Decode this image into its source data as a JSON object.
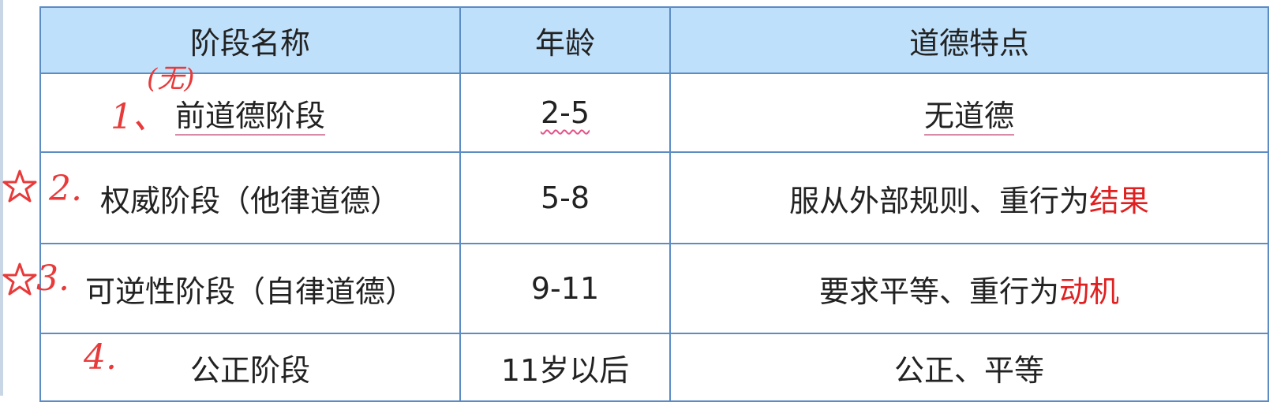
{
  "table": {
    "headers": [
      "阶段名称",
      "年龄",
      "道德特点"
    ],
    "rows": [
      {
        "stage_num": "1、",
        "stage": "前道德阶段",
        "age": "2-5",
        "feature": "无道德",
        "feature_red": ""
      },
      {
        "stage_num": "2.",
        "stage": "权威阶段（他律道德）",
        "age": "5-8",
        "feature": "服从外部规则、重行为",
        "feature_red": "结果"
      },
      {
        "stage_num": "3.",
        "stage": "可逆性阶段（自律道德）",
        "age": "9-11",
        "feature": "要求平等、重行为",
        "feature_red": "动机"
      },
      {
        "stage_num": "4.",
        "stage": "公正阶段",
        "age": "11岁以后",
        "feature": "公正、平等",
        "feature_red": ""
      }
    ]
  },
  "annotations": {
    "above_stage_1": "(无)"
  },
  "colors": {
    "header_bg": "#bfe0fb",
    "border": "#5b8cc4",
    "highlight_red": "#e02020",
    "handwriting_red": "#e83a3a"
  }
}
